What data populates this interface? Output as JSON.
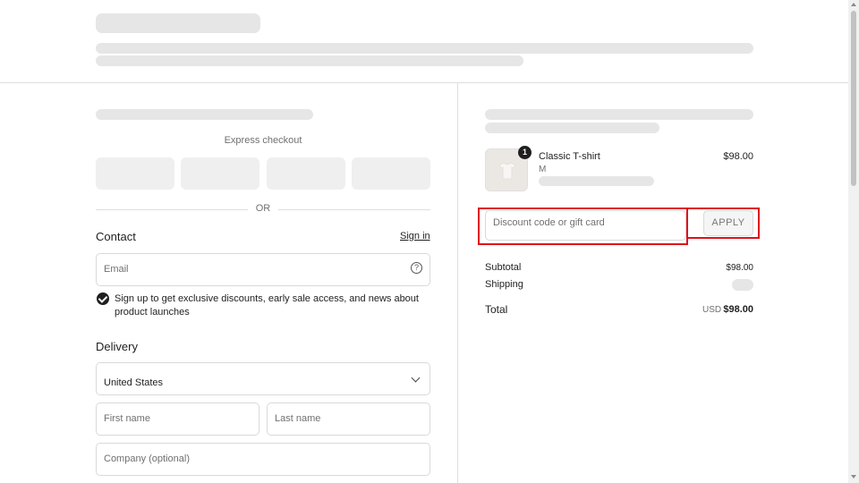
{
  "express": {
    "label": "Express checkout",
    "divider_text": "OR"
  },
  "contact": {
    "title": "Contact",
    "sign_in": "Sign in",
    "email_placeholder": "Email",
    "help_icon": "?",
    "marketing_optin": "Sign up to get exclusive discounts, early sale access, and news about product launches",
    "marketing_checked": true
  },
  "delivery": {
    "title": "Delivery",
    "country": "United States",
    "first_name_placeholder": "First name",
    "last_name_placeholder": "Last name",
    "company_placeholder": "Company (optional)"
  },
  "order": {
    "item": {
      "quantity": "1",
      "name": "Classic T-shirt",
      "variant": "M",
      "price": "$98.00"
    },
    "discount_placeholder": "Discount code or gift card",
    "apply_label": "APPLY",
    "subtotal_label": "Subtotal",
    "subtotal_value": "$98.00",
    "shipping_label": "Shipping",
    "total_label": "Total",
    "total_currency": "USD",
    "total_value": "$98.00"
  },
  "colors": {
    "highlight": "#e0101a",
    "skeleton": "#e6e6e6",
    "text": "#1f1f1f",
    "muted": "#707070"
  }
}
